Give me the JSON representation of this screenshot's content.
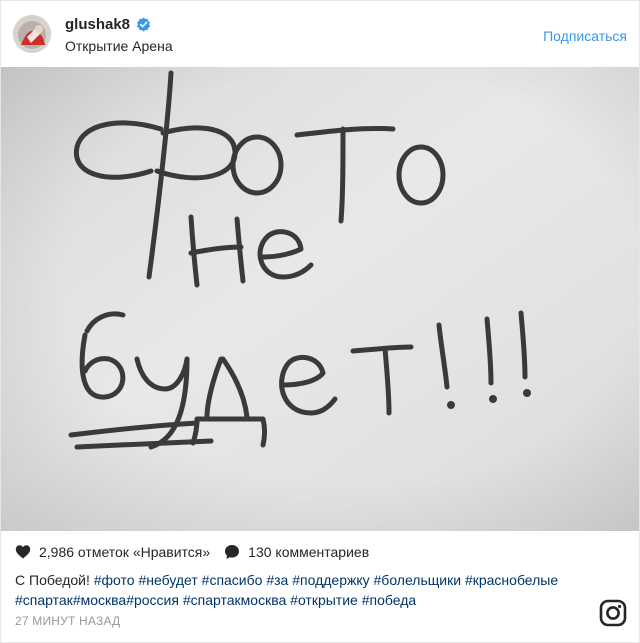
{
  "header": {
    "username": "glushak8",
    "location": "Открытие Арена",
    "follow_label": "Подписаться",
    "avatar_icon": "profile-avatar",
    "verified_icon": "verified-badge-icon"
  },
  "photo": {
    "handwritten_lines": [
      "фото",
      "не",
      "будет !!!"
    ]
  },
  "stats": {
    "likes_text": "2,986 отметок «Нравится»",
    "comments_text": "130 комментариев",
    "heart_icon": "heart-icon",
    "comment_icon": "comment-icon"
  },
  "caption": {
    "text": "С Победой!",
    "hashtags": [
      "#фото",
      "#небудет",
      "#спасибо",
      "#за",
      "#поддержку",
      "#болельщики",
      "#краснобелые",
      "#спартак",
      "#москва",
      "#россия",
      "#спартакмосква",
      "#открытие",
      "#победа"
    ]
  },
  "timestamp": "27 МИНУТ НАЗАД",
  "colors": {
    "link_blue": "#3897f0",
    "hashtag": "#003569",
    "muted": "#999999"
  }
}
